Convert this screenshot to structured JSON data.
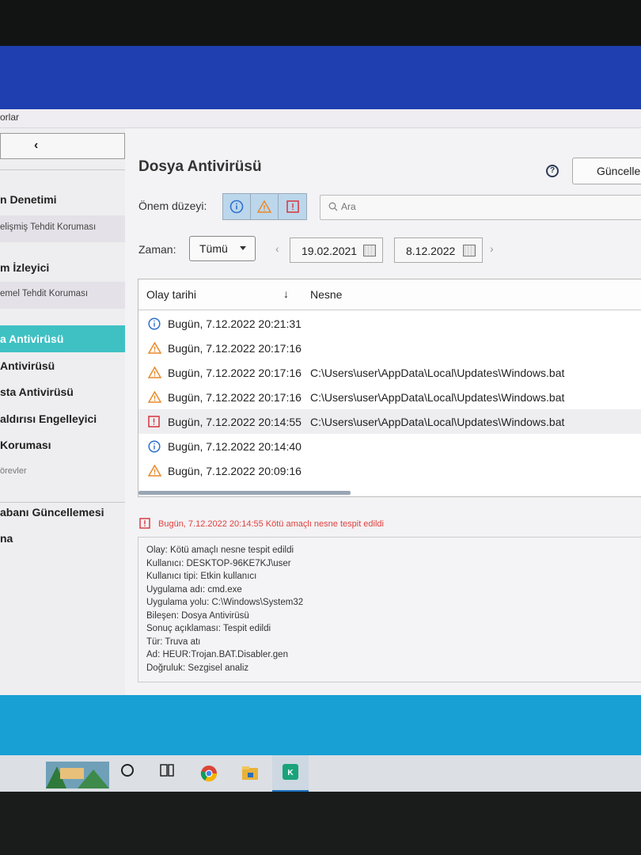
{
  "menubar": {
    "text": "orlar"
  },
  "sidebar": {
    "back_label": "‹",
    "items": [
      {
        "label": "n Denetimi",
        "kind": "bold"
      },
      {
        "label": "elişmiş Tehdit Koruması",
        "kind": "sub"
      },
      {
        "label": "m İzleyici",
        "kind": "bold"
      },
      {
        "label": "emel Tehdit Koruması",
        "kind": "sub"
      },
      {
        "label": "a Antivirüsü",
        "kind": "active"
      },
      {
        "label": "Antivirüsü",
        "kind": "bold"
      },
      {
        "label": "sta Antivirüsü",
        "kind": "bold"
      },
      {
        "label": "aldırısı Engelleyici",
        "kind": "bold"
      },
      {
        "label": "Koruması",
        "kind": "bold"
      },
      {
        "label": "örevler",
        "kind": "group"
      },
      {
        "label": "abanı Güncellemesi",
        "kind": "normal"
      },
      {
        "label": "na",
        "kind": "normal"
      }
    ]
  },
  "main": {
    "title": "Dosya Antivirüsü",
    "update_label": "Güncelle",
    "severity_label": "Önem düzeyi:",
    "search_placeholder": "Ara",
    "time_label": "Zaman:",
    "time_filter": "Tümü",
    "date_from": "19.02.2021",
    "date_to": "8.12.2022"
  },
  "table": {
    "columns": [
      "Olay tarihi",
      "Nesne"
    ],
    "rows": [
      {
        "level": "info",
        "date": "Bugün, 7.12.2022 20:21:31",
        "object": ""
      },
      {
        "level": "warning",
        "date": "Bugün, 7.12.2022 20:17:16",
        "object": ""
      },
      {
        "level": "warning",
        "date": "Bugün, 7.12.2022 20:17:16",
        "object": "C:\\Users\\user\\AppData\\Local\\Updates\\Windows.bat"
      },
      {
        "level": "warning",
        "date": "Bugün, 7.12.2022 20:17:16",
        "object": "C:\\Users\\user\\AppData\\Local\\Updates\\Windows.bat"
      },
      {
        "level": "critical",
        "date": "Bugün, 7.12.2022 20:14:55",
        "object": "C:\\Users\\user\\AppData\\Local\\Updates\\Windows.bat",
        "selected": true
      },
      {
        "level": "info",
        "date": "Bugün, 7.12.2022 20:14:40",
        "object": ""
      },
      {
        "level": "warning",
        "date": "Bugün, 7.12.2022 20:09:16",
        "object": ""
      }
    ]
  },
  "detail": {
    "header": "Bugün, 7.12.2022 20:14:55 Kötü amaçlı nesne tespit edildi",
    "lines": [
      "Olay: Kötü amaçlı nesne tespit edildi",
      "Kullanıcı: DESKTOP-96KE7KJ\\user",
      "Kullanıcı tipi: Etkin kullanıcı",
      "Uygulama adı: cmd.exe",
      "Uygulama yolu: C:\\Windows\\System32",
      "Bileşen: Dosya Antivirüsü",
      "Sonuç açıklaması: Tespit edildi",
      "Tür: Truva atı",
      "Ad: HEUR:Trojan.BAT.Disabler.gen",
      "Doğruluk: Sezgisel analiz"
    ]
  },
  "colors": {
    "info": "#2f6fd0",
    "warning": "#e8892a",
    "critical": "#d6343a",
    "accent": "#3fc1c4"
  },
  "taskbar": {
    "icons": [
      "cortana-circle-icon",
      "task-view-icon",
      "chrome-icon",
      "file-explorer-icon",
      "kaspersky-icon"
    ]
  }
}
